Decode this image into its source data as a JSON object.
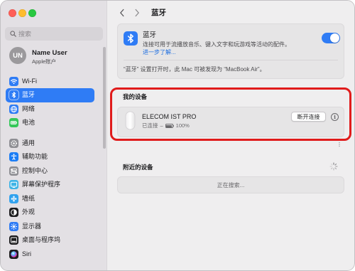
{
  "window": {
    "traffic_lights": {
      "close": "#ff5f57",
      "minimize": "#febc2e",
      "zoom": "#28c840"
    }
  },
  "sidebar": {
    "search": {
      "placeholder": "搜索",
      "value": "",
      "icon": "search-icon"
    },
    "account": {
      "initials": "UN",
      "name": "Name User",
      "subtitle": "Apple账户"
    },
    "selected_color": "#2f7cf5",
    "items": [
      {
        "label": "Wi-Fi",
        "icon": "wifi-icon",
        "icon_color": "#2f7cf5",
        "selected": false
      },
      {
        "label": "蓝牙",
        "icon": "bluetooth-icon",
        "icon_color": "#2f7cf5",
        "selected": true
      },
      {
        "label": "网络",
        "icon": "globe-icon",
        "icon_color": "#2f7cf5",
        "selected": false
      },
      {
        "label": "电池",
        "icon": "battery-icon",
        "icon_color": "#34c759",
        "selected": false
      },
      {
        "label": "通用",
        "icon": "gear-icon",
        "icon_color": "#8e8e93",
        "selected": false
      },
      {
        "label": "辅助功能",
        "icon": "accessibility-icon",
        "icon_color": "#1a7cf5",
        "selected": false
      },
      {
        "label": "控制中心",
        "icon": "control-center-icon",
        "icon_color": "#8e8e93",
        "selected": false
      },
      {
        "label": "屏幕保护程序",
        "icon": "screen-saver-icon",
        "icon_color": "#3fb4e6",
        "selected": false
      },
      {
        "label": "墙纸",
        "icon": "wallpaper-icon",
        "icon_color": "#31a2ee",
        "selected": false
      },
      {
        "label": "外观",
        "icon": "appearance-icon",
        "icon_color": "#1c1c1e",
        "selected": false
      },
      {
        "label": "显示器",
        "icon": "display-icon",
        "icon_color": "#2f7cf5",
        "selected": false
      },
      {
        "label": "桌面与程序坞",
        "icon": "dock-icon",
        "icon_color": "#1c1c1e",
        "selected": false
      },
      {
        "label": "Siri",
        "icon": "siri-icon",
        "icon_color": "#1c1c1e",
        "selected": false
      }
    ]
  },
  "toolbar": {
    "title": "蓝牙"
  },
  "bluetooth": {
    "icon_color": "#2f7cf5",
    "title": "蓝牙",
    "description": "连接可用于流播放音乐、键入文字和玩游戏等活动的配件。",
    "learn_more": "进一步了解...",
    "enabled": true,
    "discoverable_note": "“蓝牙” 设置打开时，此 Mac 可被发现为 “MacBook Air”。"
  },
  "my_devices": {
    "heading": "我的设备",
    "devices": [
      {
        "icon": "mouse-icon",
        "name": "ELECOM IST PRO",
        "status": "已连接",
        "separator": "–",
        "battery_level": 1.0,
        "battery": "100%",
        "disconnect_label": "断开连接"
      }
    ]
  },
  "nearby": {
    "heading": "附近的设备",
    "status": "正在搜索..."
  },
  "annotation": {
    "color": "#e01b1b"
  }
}
